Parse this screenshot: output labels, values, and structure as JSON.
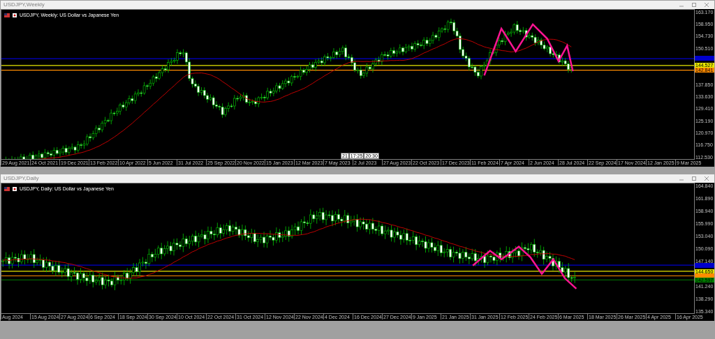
{
  "windows": [
    {
      "title": "USDJPY,Weekly",
      "chart_label": "USDJPY, Weekly:  US Dollar vs Japanese Yen",
      "kind": "weekly",
      "price_ticks": [
        "163.170",
        "158.950",
        "154.730",
        "150.510",
        "137.850",
        "133.630",
        "129.410",
        "125.190",
        "120.970",
        "116.750",
        "112.530"
      ],
      "level_lines": [
        {
          "color": "#0000cc"
        },
        {
          "color": "#e8e800",
          "label": "144.527"
        },
        {
          "color": "#ff8c00",
          "label": "142.841"
        }
      ],
      "time_labels": [
        "29 Aug 2021",
        "24 Oct 2021",
        "19 Dec 2021",
        "13 Feb 2022",
        "10 Apr 2022",
        "5 Jun 2022",
        "31 Jul 2022",
        "25 Sep 2022",
        "20 Nov 2022",
        "15 Jan 2023",
        "12 Mar 2023",
        "7 May 2023",
        "2 Jul 2023",
        "27 Aug 2023",
        "22 Oct 2023",
        "17 Dec 2023",
        "11 Feb 2024",
        "7 Apr 2024",
        "2 Jun 2024",
        "28 Jul 2024",
        "22 Sep 2024",
        "17 Nov 2024",
        "12 Jan 2025",
        "9 Mar 2025"
      ],
      "cursor_labels": [
        "21",
        "17:25",
        "20:30"
      ]
    },
    {
      "title": "USDJPY,Daily",
      "chart_label": "USDJPY, Daily:  US Dollar vs Japanese Yen",
      "kind": "daily",
      "price_ticks": [
        "164.840",
        "161.890",
        "158.940",
        "155.990",
        "153.040",
        "150.090",
        "147.140",
        "141.240",
        "138.290",
        "135.340"
      ],
      "level_lines": [
        {
          "color": "#0000cc"
        },
        {
          "color": "#e8e800",
          "label": "144.650"
        },
        {
          "color": "#ff8c00"
        },
        {
          "color": "#008000",
          "label": "142.597"
        }
      ],
      "time_labels": [
        "Aug 2024",
        "15 Aug 2024",
        "27 Aug 2024",
        "6 Sep 2024",
        "18 Sep 2024",
        "30 Sep 2024",
        "10 Oct 2024",
        "22 Oct 2024",
        "31 Oct 2024",
        "12 Nov 2024",
        "22 Nov 2024",
        "4 Dec 2024",
        "16 Dec 2024",
        "27 Dec 2024",
        "9 Jan 2025",
        "21 Jan 2025",
        "31 Jan 2025",
        "12 Feb 2025",
        "24 Feb 2025",
        "6 Mar 2025",
        "18 Mar 2025",
        "26 Mar 2025",
        "4 Apr 2025",
        "16 Apr 2025"
      ]
    }
  ]
}
